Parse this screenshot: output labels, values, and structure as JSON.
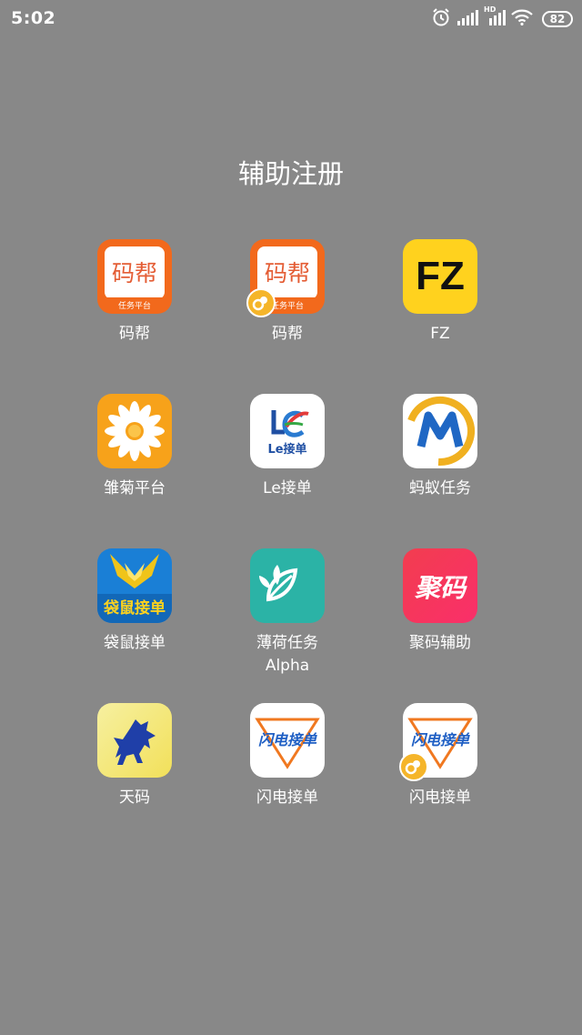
{
  "status_bar": {
    "time": "5:02",
    "icons": [
      "alarm-icon",
      "signal-icon",
      "hd-signal-icon",
      "wifi-icon",
      "battery-icon"
    ],
    "hd_label": "HD",
    "battery_level": "82"
  },
  "folder": {
    "title": "辅助注册",
    "apps": [
      {
        "label": "码帮",
        "icon": "mabang-icon",
        "icon_text": "码帮",
        "icon_subtext": "任务平台"
      },
      {
        "label": "码帮",
        "icon": "mabang-icon",
        "icon_text": "码帮",
        "icon_subtext": "任务平台",
        "clone_badge": true
      },
      {
        "label": "FZ",
        "icon": "fz-icon",
        "icon_text": "FZ"
      },
      {
        "label": "雏菊平台",
        "icon": "daisy-icon"
      },
      {
        "label": "Le接单",
        "icon": "le-icon",
        "icon_text": "Le接单"
      },
      {
        "label": "蚂蚁任务",
        "icon": "ant-task-icon"
      },
      {
        "label": "袋鼠接单",
        "icon": "kangaroo-icon",
        "icon_text": "袋鼠接单"
      },
      {
        "label": "薄荷任务",
        "label_line2": "Alpha",
        "icon": "mint-icon"
      },
      {
        "label": "聚码辅助",
        "icon": "juma-icon",
        "icon_text": "聚码"
      },
      {
        "label": "天码",
        "icon": "horse-icon"
      },
      {
        "label": "闪电接单",
        "icon": "lightning-icon",
        "icon_text": "闪电接单"
      },
      {
        "label": "闪电接单",
        "icon": "lightning-icon",
        "icon_text": "闪电接单",
        "clone_badge": true
      }
    ]
  },
  "colors": {
    "background": "#888888",
    "mabang_orange": "#f2691c",
    "fz_yellow": "#ffd21e",
    "daisy_orange": "#f7a21a",
    "mint_teal": "#2bb3a6",
    "juma_red": "#f23d4f",
    "badge_yellow": "#f5b52a"
  }
}
